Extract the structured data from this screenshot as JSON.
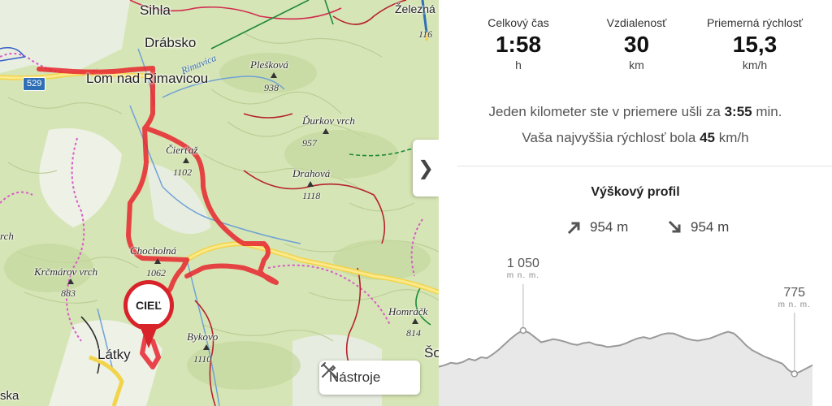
{
  "map": {
    "towns": [
      {
        "name": "Sihla"
      },
      {
        "name": "Drábsko"
      },
      {
        "name": "Lom nad Rimavicou"
      },
      {
        "name": "Látky"
      }
    ],
    "river": "Rimavica",
    "peaks": [
      {
        "name": "Plešková",
        "elev": "938"
      },
      {
        "name": "Ďurkov vrch",
        "elev": "957"
      },
      {
        "name": "Čierťaž",
        "elev": "1102"
      },
      {
        "name": "Drahová",
        "elev": "1118"
      },
      {
        "name": "Chocholná",
        "elev": "1062"
      },
      {
        "name": "Krčmárov vrch",
        "elev": "883"
      },
      {
        "name": "Bykovo",
        "elev": "1110"
      },
      {
        "name": "Homráčk",
        "elev": "814"
      }
    ],
    "partial_labels": {
      "zelezna": "Železná",
      "num116": "116",
      "rch": "rch",
      "ska": "ska",
      "so": "Šo"
    },
    "road_number": "529",
    "finish_label": "CIEĽ",
    "tools_label": "Nástroje",
    "route_color": "#e8262f"
  },
  "stats": [
    {
      "label": "Celkový čas",
      "value": "1:58",
      "unit": "h"
    },
    {
      "label": "Vzdialenosť",
      "value": "30",
      "unit": "km"
    },
    {
      "label": "Priemerná rýchlosť",
      "value": "15,3",
      "unit": "km/h"
    }
  ],
  "info": {
    "pace_prefix": "Jeden kilometer ste v priemere ušli za",
    "pace_value": "3:55",
    "pace_suffix": "min.",
    "speed_prefix": "Vaša najvyššia rýchlosť bola",
    "speed_value": "45",
    "speed_suffix": "km/h"
  },
  "profile": {
    "title": "Výškový profil",
    "ascent": "954 m",
    "descent": "954 m",
    "max_value": "1 050",
    "max_unit": "m n. m.",
    "end_value": "775",
    "end_unit": "m n. m.",
    "elevations": [
      820,
      830,
      845,
      840,
      850,
      870,
      860,
      880,
      875,
      900,
      930,
      965,
      1000,
      1030,
      1050,
      1035,
      1005,
      975,
      985,
      995,
      988,
      978,
      965,
      958,
      970,
      975,
      960,
      955,
      945,
      950,
      955,
      968,
      985,
      1000,
      1008,
      998,
      1010,
      1025,
      1032,
      1030,
      1015,
      1000,
      990,
      985,
      992,
      1000,
      1015,
      1030,
      1042,
      1030,
      995,
      955,
      925,
      905,
      885,
      870,
      855,
      840,
      800,
      775,
      790,
      810,
      830
    ]
  }
}
